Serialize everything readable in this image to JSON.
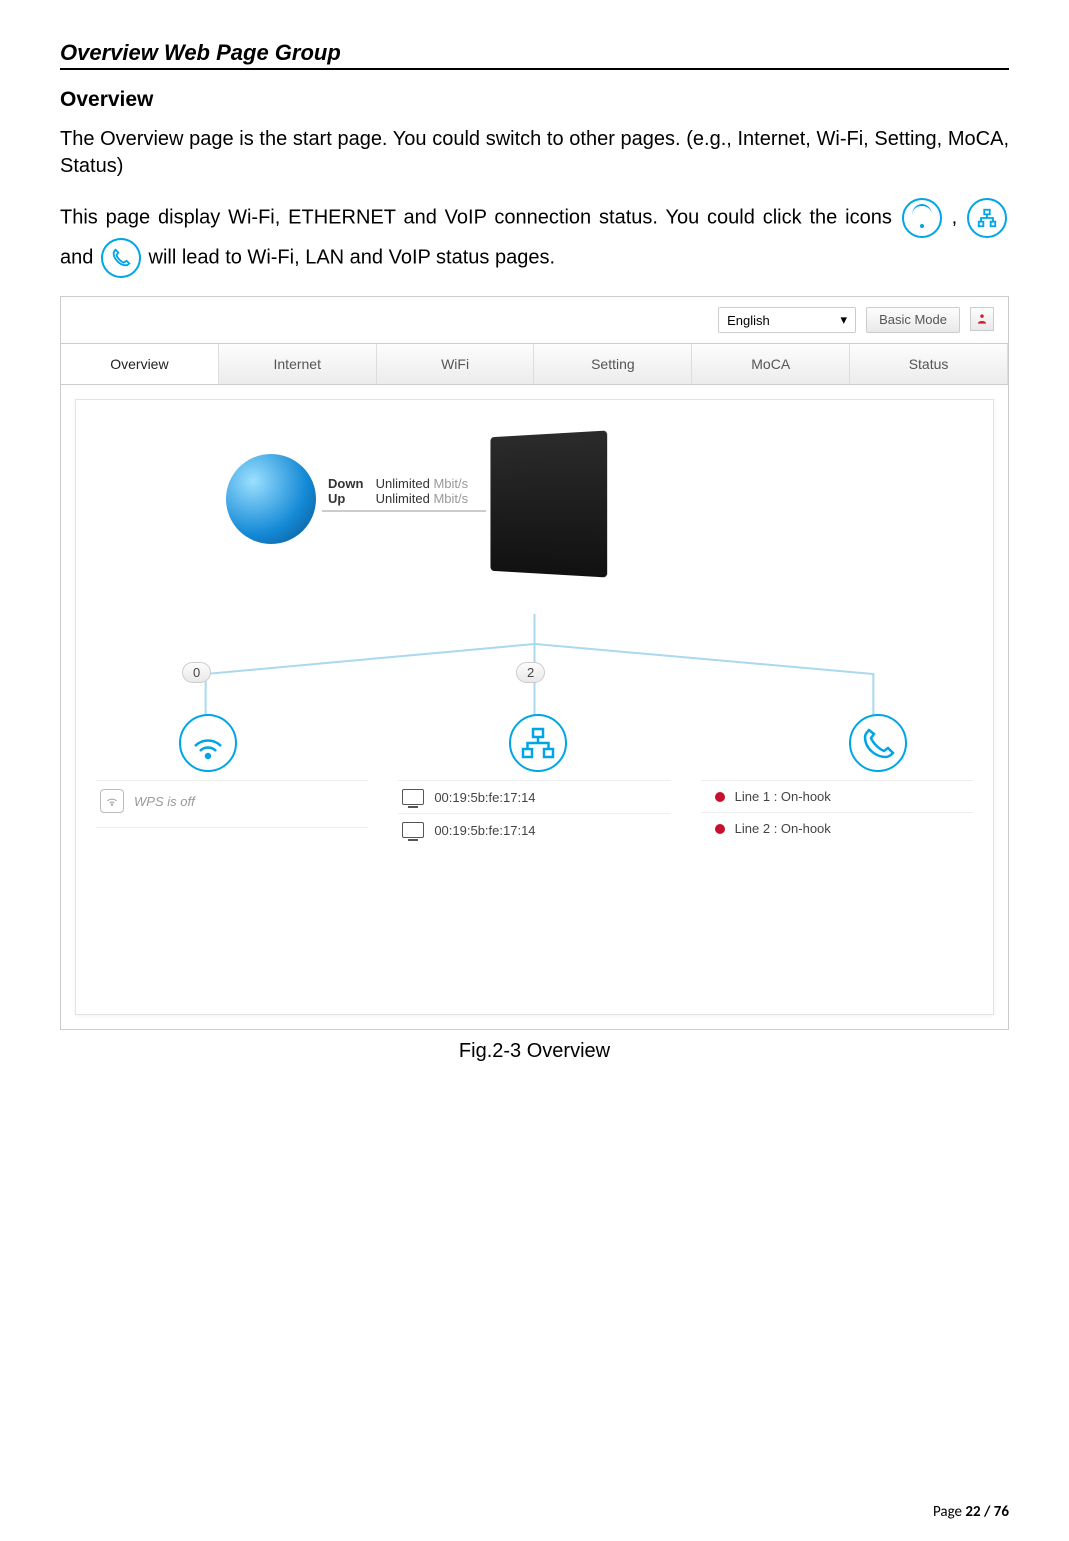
{
  "section_title": "Overview Web Page Group",
  "sub_title": "Overview",
  "para1": "The Overview page is the start page. You could switch to other pages. (e.g., Internet, Wi-Fi, Setting, MoCA, Status)",
  "para2a": "This page display Wi-Fi, ETHERNET and VoIP connection status. You could click the icons ",
  "para2b": " , ",
  "para2c": " and ",
  "para2d": " will lead to Wi-Fi, LAN and VoIP status pages.",
  "topbar": {
    "language": "English",
    "mode_button": "Basic Mode"
  },
  "tabs": [
    "Overview",
    "Internet",
    "WiFi",
    "Setting",
    "MoCA",
    "Status"
  ],
  "speed": {
    "down_label": "Down",
    "down_value": "Unlimited",
    "down_unit": "Mbit/s",
    "up_label": "Up",
    "up_value": "Unlimited",
    "up_unit": "Mbit/s"
  },
  "badge_wifi": "0",
  "badge_lan": "2",
  "wifi_col": {
    "wps": "WPS is off"
  },
  "lan_col": {
    "mac1": "00:19:5b:fe:17:14",
    "mac2": "00:19:5b:fe:17:14"
  },
  "voip_col": {
    "line1": "Line 1 : On-hook",
    "line2": "Line 2 : On-hook"
  },
  "figure_caption": "Fig.2-3 Overview",
  "page_number_prefix": "Page ",
  "page_number": "22 / 76"
}
